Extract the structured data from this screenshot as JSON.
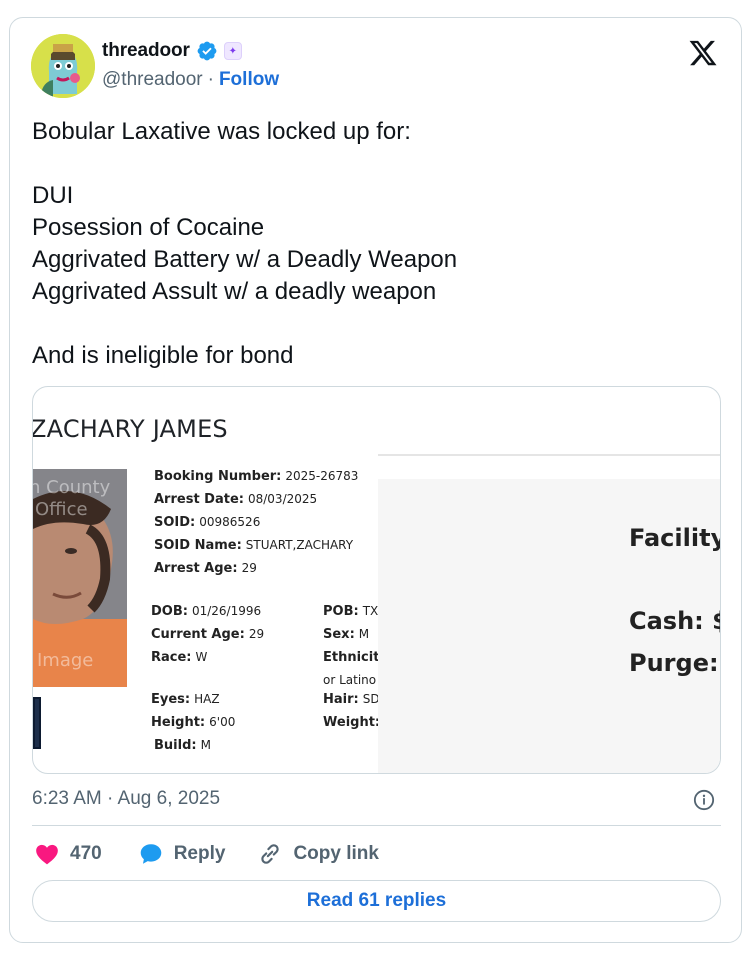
{
  "author": {
    "display_name": "threadoor",
    "handle": "@threadoor",
    "separator": "·",
    "follow_label": "Follow",
    "affiliate_badge": "✦"
  },
  "tweet": {
    "text": "Bobular Laxative was locked up for:\n\nDUI\nPosession of Cocaine\nAggrivated Battery w/ a Deadly Weapon\nAggrivated Assult w/ a deadly weapon\n\nAnd is ineligible for bond",
    "timestamp": "6:23 AM · Aug 6, 2025"
  },
  "media": {
    "name_header": "ZACHARY JAMES",
    "mugshot_text_1": "h County",
    "mugshot_text_2": "Office",
    "mugshot_text_3": "Image",
    "fields": {
      "booking_number": {
        "label": "Booking Number:",
        "value": "2025-26783"
      },
      "arrest_date": {
        "label": "Arrest Date:",
        "value": "08/03/2025"
      },
      "soid": {
        "label": "SOID:",
        "value": "00986526"
      },
      "soid_name": {
        "label": "SOID Name:",
        "value": "STUART,ZACHARY"
      },
      "arrest_age": {
        "label": "Arrest Age:",
        "value": "29"
      },
      "dob": {
        "label": "DOB:",
        "value": "01/26/1996"
      },
      "current_age": {
        "label": "Current Age:",
        "value": "29"
      },
      "race": {
        "label": "Race:",
        "value": "W"
      },
      "eyes": {
        "label": "Eyes:",
        "value": "HAZ"
      },
      "height": {
        "label": "Height:",
        "value": "6'00"
      },
      "build": {
        "label": "Build:",
        "value": "M"
      },
      "pob": {
        "label": "POB:",
        "value": "TX"
      },
      "sex": {
        "label": "Sex:",
        "value": "M"
      },
      "ethnicity": {
        "label": "Ethnicit",
        "value": "or Latino"
      },
      "hair": {
        "label": "Hair:",
        "value": "SD"
      },
      "weight": {
        "label": "Weight:",
        "value": ""
      }
    },
    "right_panel": {
      "facility": "Facility",
      "cash": "Cash: $",
      "purge": "Purge:"
    }
  },
  "actions": {
    "likes": "470",
    "reply_label": "Reply",
    "copy_link_label": "Copy link",
    "read_replies_label": "Read 61 replies"
  },
  "colors": {
    "link_blue": "#1d6fd8",
    "like_pink": "#f91880",
    "reply_blue": "#1d9bf0",
    "muted": "#536471",
    "border": "#cfd9de"
  }
}
